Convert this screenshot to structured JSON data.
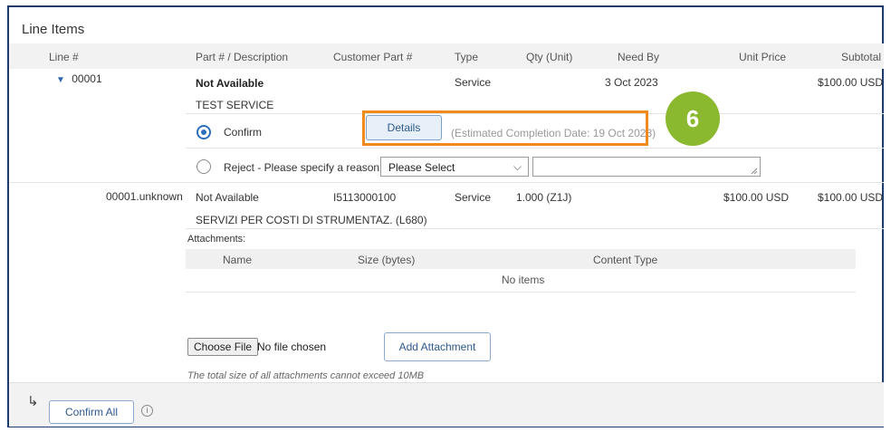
{
  "section_title": "Line Items",
  "columns": {
    "line": "Line #",
    "part": "Part # / Description",
    "customer_part": "Customer Part #",
    "type": "Type",
    "qty": "Qty (Unit)",
    "need_by": "Need By",
    "unit_price": "Unit Price",
    "subtotal": "Subtotal"
  },
  "line1": {
    "number": "00001",
    "part": "Not Available",
    "description": "TEST SERVICE",
    "type": "Service",
    "need_by": "3 Oct 2023",
    "subtotal": "$100.00 USD",
    "confirm_label": "Confirm",
    "details_label": "Details",
    "estimated_completion": "(Estimated Completion Date: 19 Oct 2023)",
    "reject_label": "Reject - Please specify a reason:",
    "reject_select": "Please Select",
    "callout_number": "6"
  },
  "line2": {
    "number": "00001.unknown",
    "part": "Not Available",
    "customer_part": "I5113000100",
    "type": "Service",
    "qty": "1.000 (Z1J)",
    "unit_price": "$100.00 USD",
    "subtotal": "$100.00 USD",
    "description": "SERVIZI PER COSTI DI STRUMENTAZ. (L680)"
  },
  "attachments": {
    "label": "Attachments:",
    "col_name": "Name",
    "col_size": "Size (bytes)",
    "col_content_type": "Content Type",
    "empty": "No items",
    "choose_file": "Choose File",
    "no_file": "No file chosen",
    "add_button": "Add Attachment",
    "size_note": "The total size of all attachments cannot exceed 10MB"
  },
  "footer": {
    "confirm_all": "Confirm All",
    "arrow": "↳",
    "info": "i"
  },
  "colors": {
    "accent": "#2c6fbe",
    "highlight_border": "#f28a1b",
    "callout_badge": "#8ab82f",
    "frame": "#1f3a6e"
  }
}
